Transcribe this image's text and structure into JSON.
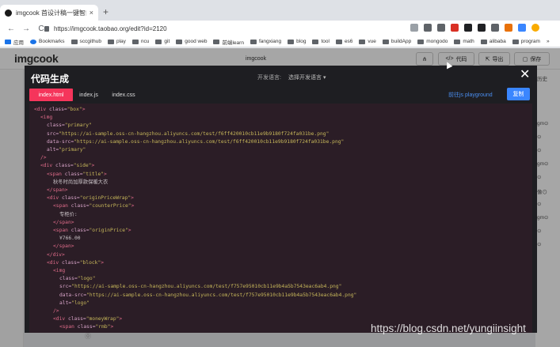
{
  "browser": {
    "tab_title": "imgcook 首设计稿一键智能生成",
    "tab_close": "×",
    "new_tab": "+",
    "nav": {
      "back": "←",
      "forward": "→",
      "reload": "C"
    },
    "url": "https://imgcook.taobao.org/edit?id=2120",
    "bookmarks": [
      {
        "label": "应用",
        "icon": "apps-icon"
      },
      {
        "label": "Bookmarks",
        "icon": "star-icon"
      },
      {
        "label": "sccgithub",
        "icon": "github-icon"
      },
      {
        "label": "play",
        "icon": "folder-icon"
      },
      {
        "label": "ncu",
        "icon": "folder-icon"
      },
      {
        "label": "git",
        "icon": "folder-icon"
      },
      {
        "label": "good web",
        "icon": "folder-icon"
      },
      {
        "label": "前端learn",
        "icon": "folder-icon"
      },
      {
        "label": "fangxiang",
        "icon": "folder-icon"
      },
      {
        "label": "blog",
        "icon": "folder-icon"
      },
      {
        "label": "tool",
        "icon": "folder-icon"
      },
      {
        "label": "es6",
        "icon": "folder-icon"
      },
      {
        "label": "vue",
        "icon": "folder-icon"
      },
      {
        "label": "buildApp",
        "icon": "folder-icon"
      },
      {
        "label": "mongodo",
        "icon": "folder-icon"
      },
      {
        "label": "math",
        "icon": "folder-icon"
      },
      {
        "label": "alibaba",
        "icon": "folder-icon"
      },
      {
        "label": "program",
        "icon": "folder-icon"
      }
    ],
    "bookmarks_more": "»"
  },
  "app": {
    "logo": "imgcook",
    "title": "imgcook",
    "buttons": {
      "code": "代码",
      "export": "导出",
      "save": "保存"
    },
    "side_labels": [
      "gm⊙",
      "⊙",
      "⊙",
      "gm⊙",
      "⊙",
      "像⊙",
      "⊙",
      "gm⊙",
      "⊙",
      "⊙"
    ],
    "right_header": "历史"
  },
  "modal": {
    "title": "代码生成",
    "lang_label": "开发语言:",
    "lang_select": "选择开发语言 ▾",
    "close": "✕",
    "tabs": [
      "index.html",
      "index.js",
      "index.css"
    ],
    "playground": "前往js playground",
    "copy": "复制",
    "code_lines": [
      {
        "indent": 0,
        "segments": [
          [
            "t",
            "<div "
          ],
          [
            "a",
            "class="
          ],
          [
            "s",
            "\"box\""
          ],
          [
            "t",
            ">"
          ]
        ]
      },
      {
        "indent": 1,
        "segments": [
          [
            "t",
            "<img"
          ]
        ]
      },
      {
        "indent": 2,
        "segments": [
          [
            "a",
            "class="
          ],
          [
            "s",
            "\"primary\""
          ]
        ]
      },
      {
        "indent": 2,
        "segments": [
          [
            "a",
            "src="
          ],
          [
            "s",
            "\"https://ai-sample.oss-cn-hangzhou.aliyuncs.com/test/f6ff420010cb11e9b9180f724fa031be.png\""
          ]
        ]
      },
      {
        "indent": 2,
        "segments": [
          [
            "a",
            "data-src="
          ],
          [
            "s",
            "\"https://ai-sample.oss-cn-hangzhou.aliyuncs.com/test/f6ff420010cb11e9b9180f724fa031be.png\""
          ]
        ]
      },
      {
        "indent": 2,
        "segments": [
          [
            "a",
            "alt="
          ],
          [
            "s",
            "\"primary\""
          ]
        ]
      },
      {
        "indent": 1,
        "segments": [
          [
            "t",
            "/>"
          ]
        ]
      },
      {
        "indent": 1,
        "segments": [
          [
            "t",
            "<div "
          ],
          [
            "a",
            "class="
          ],
          [
            "s",
            "\"side\""
          ],
          [
            "t",
            ">"
          ]
        ]
      },
      {
        "indent": 2,
        "segments": [
          [
            "t",
            "<span "
          ],
          [
            "a",
            "class="
          ],
          [
            "s",
            "\"title\""
          ],
          [
            "t",
            ">"
          ]
        ]
      },
      {
        "indent": 3,
        "segments": [
          [
            "x",
            "秋冬时尚加厚款保暖大衣"
          ]
        ]
      },
      {
        "indent": 2,
        "segments": [
          [
            "t",
            "</span>"
          ]
        ]
      },
      {
        "indent": 2,
        "segments": [
          [
            "t",
            "<div "
          ],
          [
            "a",
            "class="
          ],
          [
            "s",
            "\"originPriceWrap\""
          ],
          [
            "t",
            ">"
          ]
        ]
      },
      {
        "indent": 3,
        "segments": [
          [
            "t",
            "<span "
          ],
          [
            "a",
            "class="
          ],
          [
            "s",
            "\"counterPrice\""
          ],
          [
            "t",
            ">"
          ]
        ]
      },
      {
        "indent": 4,
        "segments": [
          [
            "x",
            "专柜价:"
          ]
        ]
      },
      {
        "indent": 3,
        "segments": [
          [
            "t",
            "</span>"
          ]
        ]
      },
      {
        "indent": 3,
        "segments": [
          [
            "t",
            "<span "
          ],
          [
            "a",
            "class="
          ],
          [
            "s",
            "\"originPrice\""
          ],
          [
            "t",
            ">"
          ]
        ]
      },
      {
        "indent": 4,
        "segments": [
          [
            "x",
            "¥766.00"
          ]
        ]
      },
      {
        "indent": 3,
        "segments": [
          [
            "t",
            "</span>"
          ]
        ]
      },
      {
        "indent": 2,
        "segments": [
          [
            "t",
            "</div>"
          ]
        ]
      },
      {
        "indent": 2,
        "segments": [
          [
            "t",
            "<div "
          ],
          [
            "a",
            "class="
          ],
          [
            "s",
            "\"block\""
          ],
          [
            "t",
            ">"
          ]
        ]
      },
      {
        "indent": 3,
        "segments": [
          [
            "t",
            "<img"
          ]
        ]
      },
      {
        "indent": 4,
        "segments": [
          [
            "a",
            "class="
          ],
          [
            "s",
            "\"logo\""
          ]
        ]
      },
      {
        "indent": 4,
        "segments": [
          [
            "a",
            "src="
          ],
          [
            "s",
            "\"https://ai-sample.oss-cn-hangzhou.aliyuncs.com/test/f757e95010cb11e9b4a5b7543eac6ab4.png\""
          ]
        ]
      },
      {
        "indent": 4,
        "segments": [
          [
            "a",
            "data-src="
          ],
          [
            "s",
            "\"https://ai-sample.oss-cn-hangzhou.aliyuncs.com/test/f757e95010cb11e9b4a5b7543eac6ab4.png\""
          ]
        ]
      },
      {
        "indent": 4,
        "segments": [
          [
            "a",
            "alt="
          ],
          [
            "s",
            "\"logo\""
          ]
        ]
      },
      {
        "indent": 3,
        "segments": [
          [
            "t",
            "/>"
          ]
        ]
      },
      {
        "indent": 3,
        "segments": [
          [
            "t",
            "<div "
          ],
          [
            "a",
            "class="
          ],
          [
            "s",
            "\"moneyWrap\""
          ],
          [
            "t",
            ">"
          ]
        ]
      },
      {
        "indent": 4,
        "segments": [
          [
            "t",
            "<span "
          ],
          [
            "a",
            "class="
          ],
          [
            "s",
            "\"rmb\""
          ],
          [
            "t",
            ">"
          ]
        ]
      }
    ]
  },
  "watermark": "https://blog.csdn.net/yungiinsight",
  "colors": {
    "tag": "#e06c8a",
    "attr": "#d6a2c6",
    "string": "#c6b65a",
    "text": "#c9c2c6",
    "accent": "#f5355b",
    "primary": "#3a86ff"
  }
}
